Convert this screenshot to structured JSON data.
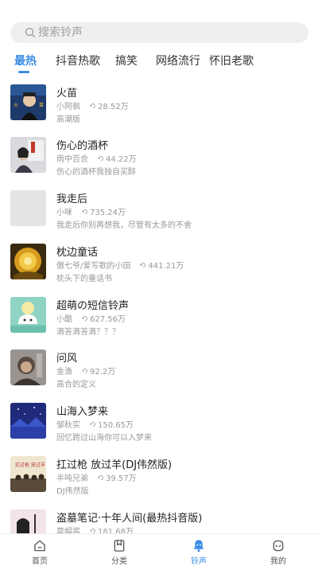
{
  "search": {
    "placeholder": "搜索铃声"
  },
  "tabs": [
    {
      "label": "最热"
    },
    {
      "label": "抖音热歌"
    },
    {
      "label": "搞笑"
    },
    {
      "label": "网络流行"
    },
    {
      "label": "怀旧老歌"
    }
  ],
  "songs": [
    {
      "title": "火苗",
      "artist": "小阿枫",
      "plays": "28.52万",
      "desc": "高潮版"
    },
    {
      "title": "伤心的酒杯",
      "artist": "雨中百合",
      "plays": "44.22万",
      "desc": "伤心的酒杯我独自买醉"
    },
    {
      "title": "我走后",
      "artist": "小咪",
      "plays": "735.24万",
      "desc": "我走后你别再想我，尽管有太多的不舍"
    },
    {
      "title": "枕边童话",
      "artist": "傲七爷/爱写歌的小田",
      "plays": "441.21万",
      "desc": "枕头下的童话书"
    },
    {
      "title": "超萌の短信铃声",
      "artist": "小酷",
      "plays": "627.56万",
      "desc": "滴答滴答滴？？？"
    },
    {
      "title": "问风",
      "artist": "金渔",
      "plays": "92.2万",
      "desc": "高合的定义"
    },
    {
      "title": "山海入梦来",
      "artist": "邹秋实",
      "plays": "150.65万",
      "desc": "回忆跨过山海你可以入梦来"
    },
    {
      "title": "扛过枪 放过羊(DJ伟然版)",
      "artist": "半吨兄弟",
      "plays": "39.57万",
      "desc": "DJ伟然版"
    },
    {
      "title": "盗墓笔记·十年人间(最热抖音版)",
      "artist": "草帽酱",
      "plays": "181.68万",
      "desc": ""
    }
  ],
  "covers": {
    "song1_text": "火 苗",
    "song8_text": "扛过枪 放过羊"
  },
  "nav": [
    {
      "label": "首页",
      "icon": "home-icon"
    },
    {
      "label": "分类",
      "icon": "category-icon"
    },
    {
      "label": "铃声",
      "icon": "ringtone-icon"
    },
    {
      "label": "我的",
      "icon": "profile-icon"
    }
  ],
  "colors": {
    "accent": "#3a8ee6",
    "muted": "#999999",
    "search_bg": "#eeeff1"
  }
}
